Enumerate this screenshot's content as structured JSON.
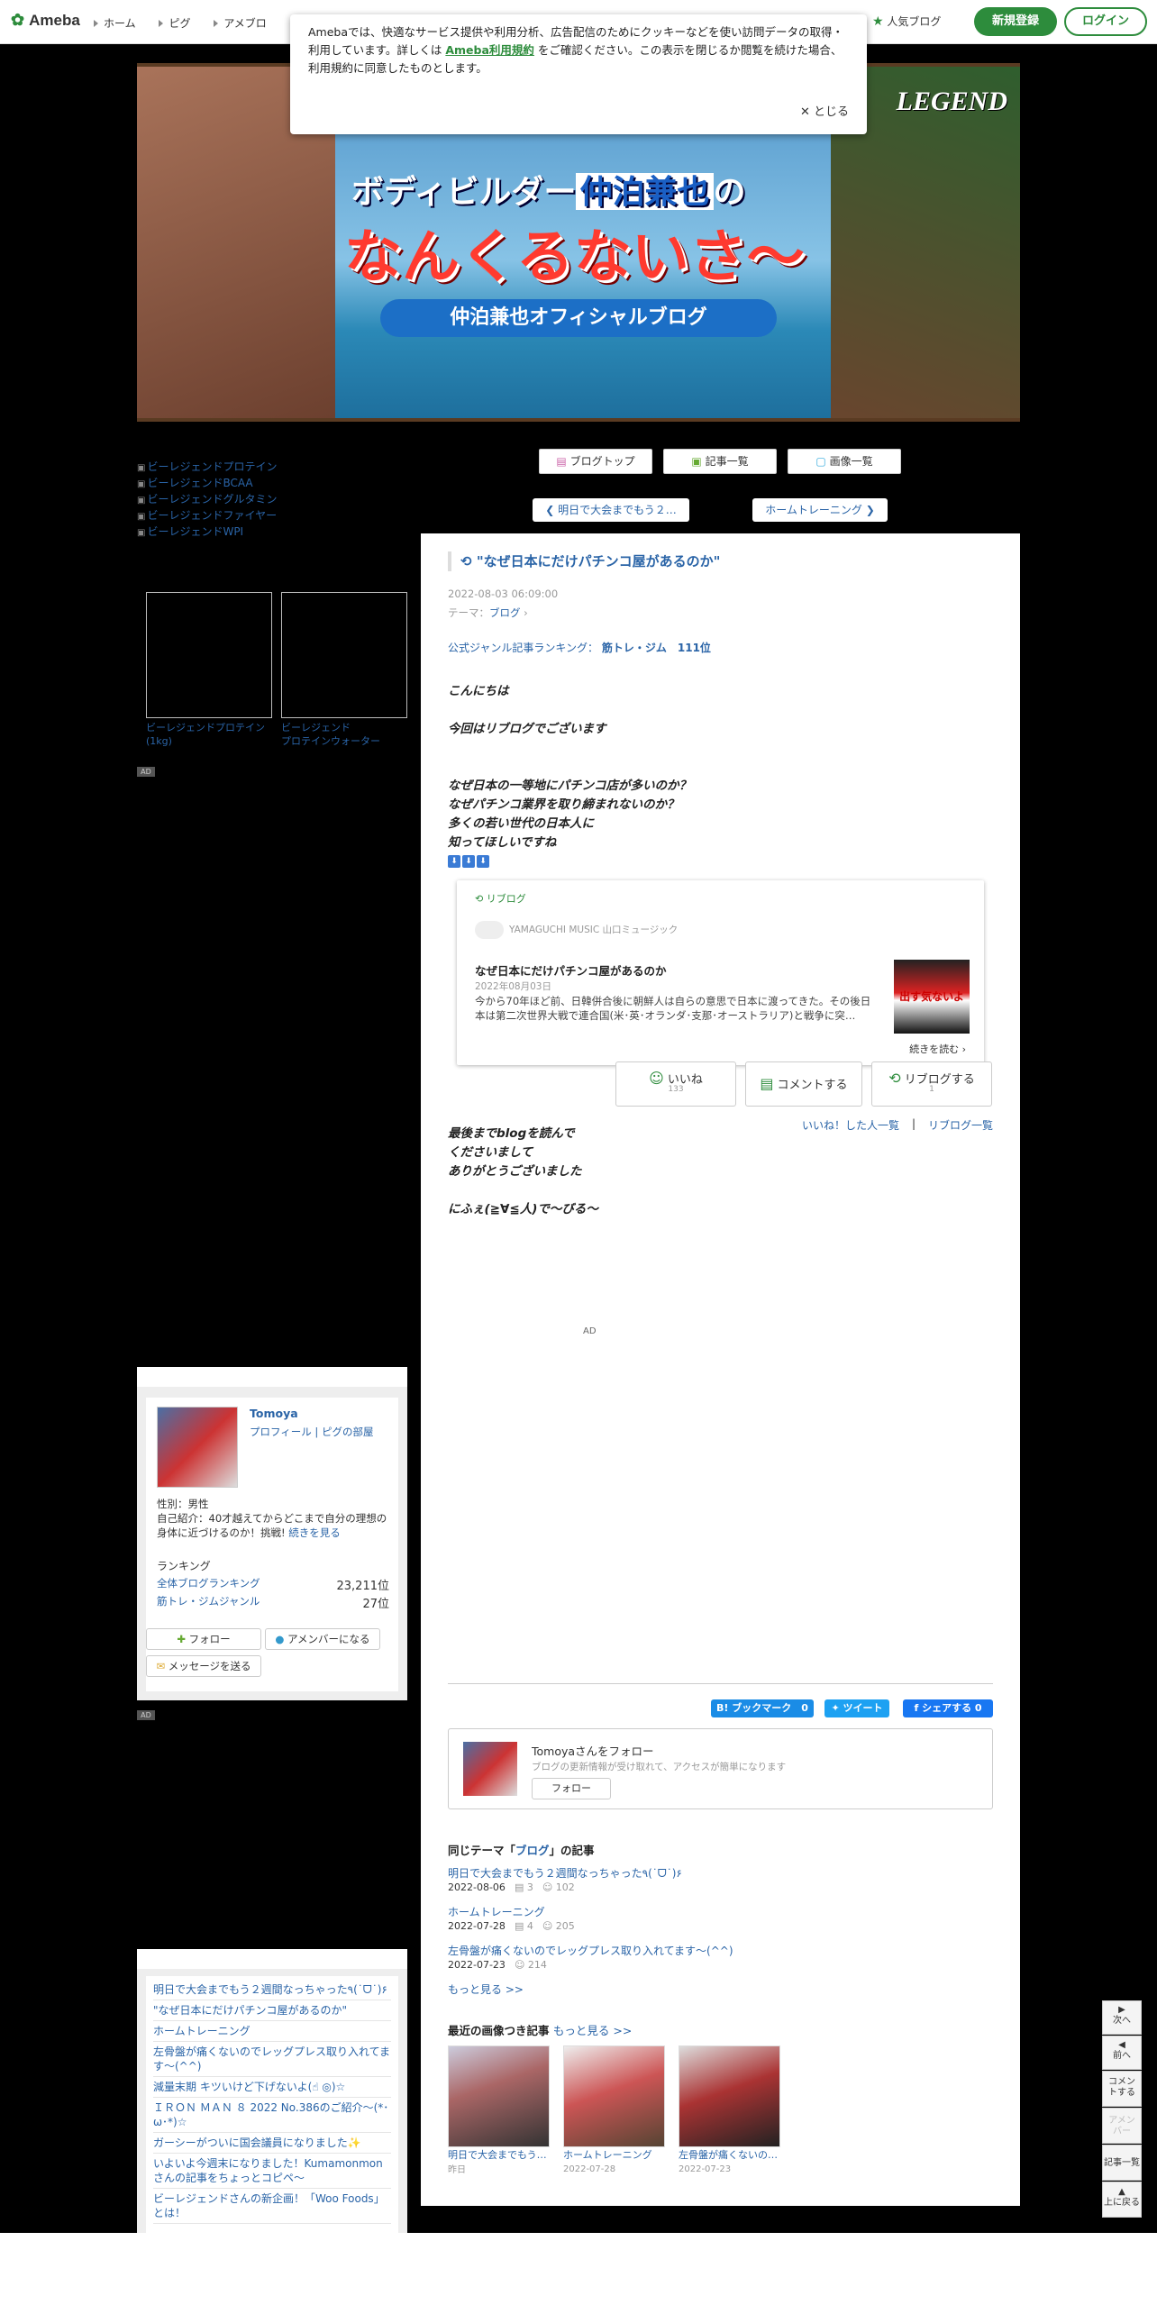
{
  "header": {
    "logo": "Ameba",
    "nav": [
      "ホーム",
      "ピグ",
      "アメブロ"
    ],
    "popular": "人気ブログ",
    "register": "新規登録",
    "login": "ログイン"
  },
  "cookie": {
    "text_pre": "Amebaでは、快適なサービス提供や利用分析、広告配信のためにクッキーなどを使い訪問データの取得・利用しています。詳しくは ",
    "link": "Ameba利用規約",
    "text_post": " をご確認ください。この表示を閉じるか閲覧を続けた場合、利用規約に同意したものとします。",
    "close": "とじる"
  },
  "banner": {
    "line1_pre": "ボディビルダー",
    "line1_name": "仲泊兼也",
    "line1_post": "の",
    "line2": "なんくるないさ～",
    "line3": "仲泊兼也オフィシャルブログ",
    "logo": "LEGEND"
  },
  "sidebar": {
    "links": [
      "ビーレジェンドプロテイン",
      "ビーレジェンドBCAA",
      "ビーレジェンドグルタミン",
      "ビーレジェンドファイヤー",
      "ビーレジェンドWPI"
    ],
    "products": [
      "ビーレジェンドプロテイン(1kg)",
      "ビーレジェンド\nプロテインウォーター"
    ],
    "ad": "AD",
    "profile": {
      "name": "Tomoya",
      "link_profile": "プロフィール",
      "link_pig": "ピグの部屋",
      "sex": "性別：男性",
      "intro": "自己紹介：40才越えてからどこまで自分の理想の身体に近づけるのか！挑戦!",
      "more": "続きを見る",
      "ranking_label": "ランキング",
      "rank_all_label": "全体ブログランキング",
      "rank_all_value": "23,211位",
      "rank_genre_label": "筋トレ・ジムジャンル",
      "rank_genre_value": "27位",
      "follow": "フォロー",
      "member": "アメンバーになる",
      "message": "メッセージを送る"
    },
    "recent": [
      "明日で大会までもう２週間なっちゃった٩(˙ᗜ˙)۶",
      "\"なぜ日本にだけパチンコ屋があるのか\"",
      "ホームトレーニング",
      "左骨盤が痛くないのでレッグプレス取り入れてます〜(^^)",
      "減量末期 キツいけど下げないよ(☝ ◎)☆",
      "ＩＲＯＮ ＭＡＮ ８ 2022 No.386のご紹介〜(*･ω･*)☆",
      "ガーシーがついに国会議員になりました✨",
      "いよいよ今週末になりました！Kumamonmonさんの記事をちょっとコピペ〜",
      "ビーレジェンドさんの新企画！「Woo Foods」とは！"
    ]
  },
  "tabs": [
    "ブログトップ",
    "記事一覧",
    "画像一覧"
  ],
  "pager": {
    "prev": "明日で大会までもう２…",
    "next": "ホームトレーニング"
  },
  "article": {
    "title": "\"なぜ日本にだけパチンコ屋があるのか\"",
    "date": "2022-08-03 06:09:00",
    "theme_label": "テーマ：",
    "theme": "ブログ",
    "ranking_label": "公式ジャンル記事ランキング：",
    "ranking_value": "筋トレ・ジム　111位",
    "p1": "こんにちは",
    "p2": "今回はリブログでございます",
    "p3a": "なぜ日本の一等地にパチンコ店が多いのか？",
    "p3b": "なぜパチンコ業界を取り締まれないのか？",
    "p3c": "多くの若い世代の日本人に",
    "p3d": "知ってほしいですね",
    "reblog": {
      "tag": "リブログ",
      "source": "YAMAGUCHI MUSIC 山口ミュージック",
      "title": "なぜ日本にだけパチンコ屋があるのか",
      "date": "2022年08月03日",
      "excerpt": "今から70年ほど前、日韓併合後に朝鮮人は自らの意思で日本に渡ってきた。その後日本は第二次世界大戦で連合国(米･英･オランダ･支那･オーストラリア)と戦争に突…",
      "thumb": "出す気ないよ",
      "more": "続きを読む"
    },
    "p4a": "最後までblogを読んで",
    "p4b": "くださいまして",
    "p4c": "ありがとうございました",
    "p5": "にふぇ(≧∀≦人)で〜びる～",
    "ad": "AD"
  },
  "actions": {
    "like": "いいね",
    "like_count": "133",
    "comment": "コメントする",
    "reblog": "リブログする",
    "reblog_count": "1",
    "liked_list": "いいね！した人一覧",
    "reblog_list": "リブログ一覧"
  },
  "share": {
    "hatena": "B! ブックマーク　0",
    "tweet": "ツイート",
    "facebook": "シェアする 0"
  },
  "follow": {
    "name": "Tomoyaさんをフォロー",
    "desc": "ブログの更新情報が受け取れて、アクセスが簡単になります",
    "btn": "フォロー"
  },
  "related": {
    "heading_pre": "同じテーマ「",
    "heading_theme": "ブログ",
    "heading_post": "」の記事",
    "items": [
      {
        "title": "明日で大会までもう２週間なっちゃった٩(˙ᗜ˙)۶",
        "date": "2022-08-06",
        "comments": "3",
        "likes": "102"
      },
      {
        "title": "ホームトレーニング",
        "date": "2022-07-28",
        "comments": "4",
        "likes": "205"
      },
      {
        "title": "左骨盤が痛くないのでレッグプレス取り入れてます〜(^^)",
        "date": "2022-07-23",
        "comments": "",
        "likes": "214"
      }
    ],
    "more": "もっと見る >>"
  },
  "image_articles": {
    "heading": "最近の画像つき記事",
    "more": "もっと見る >>",
    "items": [
      {
        "title": "明日で大会までもう…",
        "date": "昨日"
      },
      {
        "title": "ホームトレーニング",
        "date": "2022-07-28"
      },
      {
        "title": "左骨盤が痛くないの…",
        "date": "2022-07-23"
      }
    ]
  },
  "floatnav": {
    "next": "次へ",
    "prev": "前へ",
    "comment": "コメントする",
    "amember": "アメンバー",
    "list": "記事一覧",
    "top": "上に戻る"
  }
}
